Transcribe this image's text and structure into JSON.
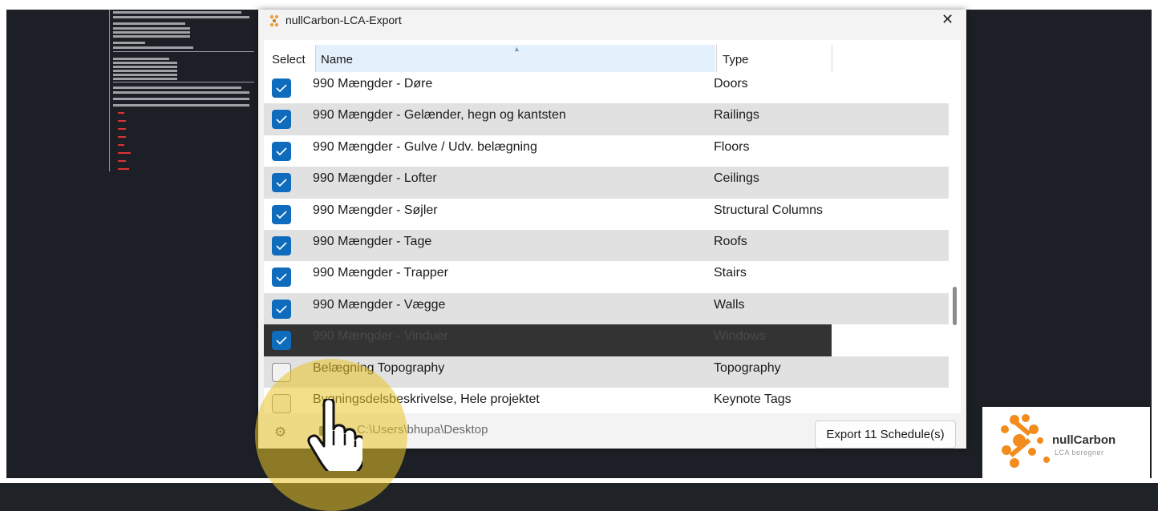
{
  "window": {
    "title": "nullCarbon-LCA-Export",
    "close_glyph": "✕"
  },
  "grid": {
    "columns": {
      "select": "Select",
      "name": "Name",
      "type": "Type"
    },
    "sort_indicator": "▲",
    "rows": [
      {
        "checked": true,
        "name": "990 Mængder - Døre",
        "type": "Doors"
      },
      {
        "checked": true,
        "name": "990 Mængder - Gelænder, hegn og kantsten",
        "type": "Railings"
      },
      {
        "checked": true,
        "name": "990 Mængder - Gulve / Udv. belægning",
        "type": "Floors"
      },
      {
        "checked": true,
        "name": "990 Mængder - Lofter",
        "type": "Ceilings"
      },
      {
        "checked": true,
        "name": "990 Mængder - Søjler",
        "type": "Structural Columns"
      },
      {
        "checked": true,
        "name": "990 Mængder - Tage",
        "type": "Roofs"
      },
      {
        "checked": true,
        "name": "990 Mængder - Trapper",
        "type": "Stairs"
      },
      {
        "checked": true,
        "name": "990 Mængder - Vægge",
        "type": "Walls"
      },
      {
        "checked": true,
        "name": "990 Mængder - Vinduer",
        "type": "Windows",
        "selected": true
      },
      {
        "checked": false,
        "name": "Belægning Topography",
        "type": "Topography"
      },
      {
        "checked": false,
        "name": "Bygningsdelsbeskrivelse, Hele projektet",
        "type": "Keynote Tags"
      }
    ]
  },
  "footer": {
    "settings_icon": "gear-icon",
    "folder_icon": "folder-icon",
    "path": "C:\\Users\\bhupa\\Desktop",
    "export_label": "Export 11 Schedule(s)"
  },
  "logo": {
    "wordmark": "nullCarbon",
    "tagline": "LCA beregner"
  },
  "colors": {
    "checkbox": "#0f6cbd",
    "highlight": "#e9c428",
    "logo_orange": "#f28c1c"
  }
}
